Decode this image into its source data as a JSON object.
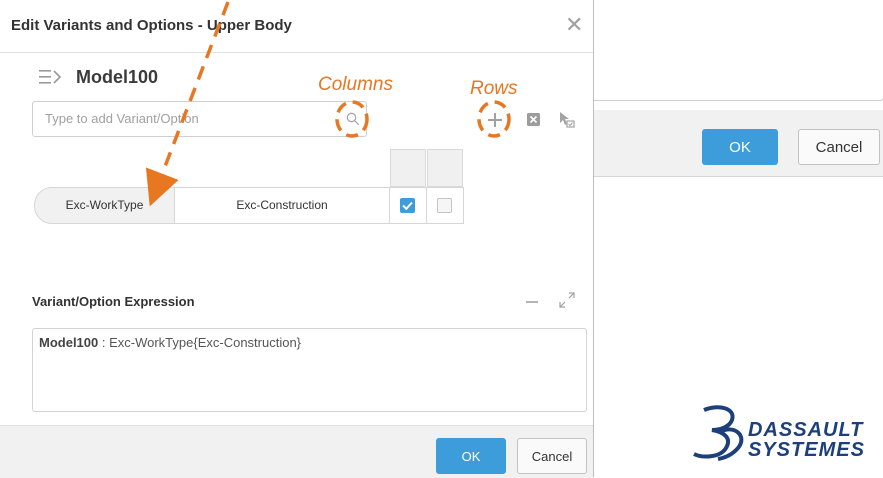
{
  "background_dialog": {
    "ok_label": "OK",
    "cancel_label": "Cancel"
  },
  "dialog": {
    "title": "Edit Variants and Options - Upper Body",
    "close_icon": "close-icon",
    "model_name": "Model100",
    "search_placeholder": "Type to add Variant/Option",
    "toolbar_icons": [
      "search-icon",
      "add-icon",
      "remove-icon",
      "select-icon"
    ],
    "grid": {
      "rows": [
        {
          "variant": "Exc-WorkType",
          "option": "Exc-Construction",
          "checks": [
            true,
            false
          ]
        }
      ]
    },
    "expression": {
      "label": "Variant/Option Expression",
      "model": "Model100",
      "text": " : Exc-WorkType{Exc-Construction}"
    },
    "ok_label": "OK",
    "cancel_label": "Cancel"
  },
  "annotations": {
    "columns": "Columns",
    "rows": "Rows"
  },
  "logo": {
    "line1": "DASSAULT",
    "line2": "SYSTEMES"
  },
  "colors": {
    "accent": "#3d9ddb",
    "annotation": "#e87722",
    "logo": "#1d3f7a"
  }
}
